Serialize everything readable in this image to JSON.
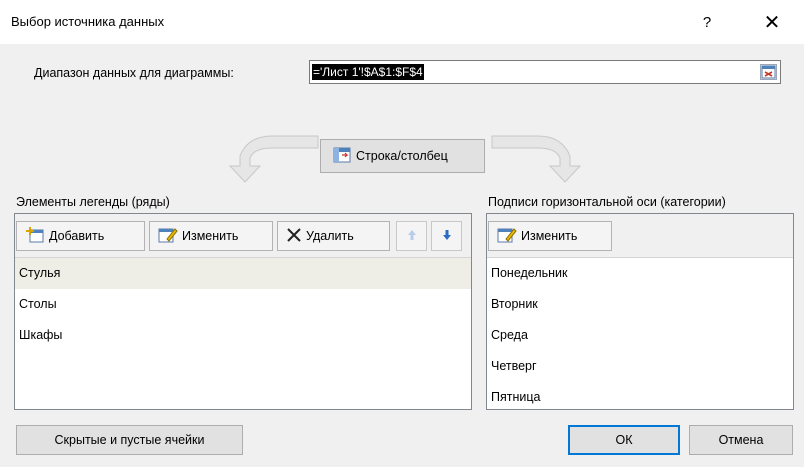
{
  "window": {
    "title": "Выбор источника данных",
    "help_label": "?",
    "close_label": "✕"
  },
  "range": {
    "label": "Диапазон данных для диаграммы:",
    "value": "='Лист 1'!$A$1:$F$4"
  },
  "switch_button": {
    "label": "Строка/столбец"
  },
  "legend": {
    "heading": "Элементы легенды (ряды)",
    "toolbar": {
      "add_label": "Добавить",
      "edit_label": "Изменить",
      "delete_label": "Удалить"
    },
    "items": [
      "Стулья",
      "Столы",
      "Шкафы"
    ],
    "selected_index": 0
  },
  "axis": {
    "heading": "Подписи горизонтальной оси (категории)",
    "edit_label": "Изменить",
    "items": [
      "Понедельник",
      "Вторник",
      "Среда",
      "Четверг",
      "Пятница"
    ]
  },
  "footer": {
    "hidden_cells_label": "Скрытые и пустые ячейки",
    "ok_label": "ОК",
    "cancel_label": "Отмена"
  },
  "colors": {
    "accent": "#0078d7",
    "selected_row": "#efeee6"
  }
}
